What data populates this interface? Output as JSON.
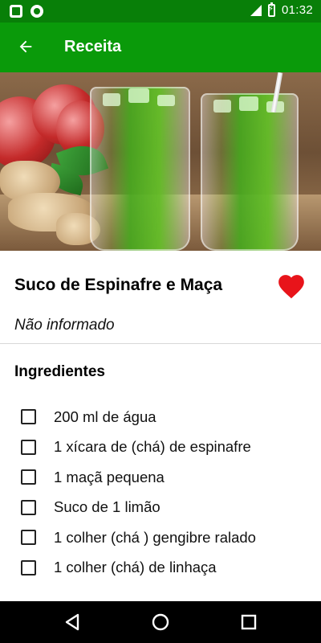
{
  "status_bar": {
    "time": "01:32"
  },
  "app_bar": {
    "title": "Receita",
    "back_icon": "arrow-back-icon"
  },
  "recipe": {
    "title": "Suco de Espinafre e Maça",
    "subtitle": "Não informado",
    "favorite": true,
    "favorite_color": "#e8141a"
  },
  "ingredients": {
    "heading": "Ingredientes",
    "items": [
      {
        "label": "200 ml de água",
        "checked": false
      },
      {
        "label": "1 xícara de (chá) de espinafre",
        "checked": false
      },
      {
        "label": "1 maçã pequena",
        "checked": false
      },
      {
        "label": "Suco de 1 limão",
        "checked": false
      },
      {
        "label": "1 colher (chá ) gengibre ralado",
        "checked": false
      },
      {
        "label": "1 colher (chá) de linhaça",
        "checked": false
      }
    ]
  },
  "colors": {
    "status_bar": "#087f08",
    "app_bar": "#0a9a0a"
  },
  "nav": {
    "icons": [
      "back-triangle-icon",
      "home-circle-icon",
      "recents-square-icon"
    ]
  }
}
